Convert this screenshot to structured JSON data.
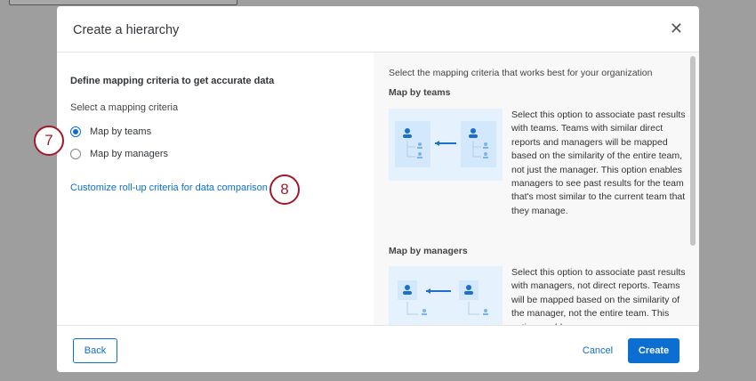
{
  "dialog": {
    "title": "Create a hierarchy",
    "close_label": "✕"
  },
  "left": {
    "heading": "Define mapping criteria to get accurate data",
    "select_label": "Select a mapping criteria",
    "options": [
      {
        "label": "Map by teams",
        "selected": true
      },
      {
        "label": "Map by managers",
        "selected": false
      }
    ],
    "link": "Customize roll-up criteria for data comparison"
  },
  "annotations": [
    "7",
    "8"
  ],
  "right": {
    "intro": "Select the mapping criteria that works best for your organization",
    "sections": [
      {
        "title": "Map by teams",
        "description": "Select this option to associate past results with teams. Teams with similar direct reports and managers will be mapped based on the similarity of the entire team, not just the manager. This option enables managers to see past results for the team that's most similar to the current team that they manage."
      },
      {
        "title": "Map by managers",
        "description": "Select this option to associate past results with managers, not direct reports. Teams will be mapped based on the similarity of the manager, not the entire team. This option enables..."
      }
    ]
  },
  "footer": {
    "back": "Back",
    "cancel": "Cancel",
    "create": "Create"
  },
  "colors": {
    "accent": "#0b6ed0",
    "annotation": "#a3192a"
  }
}
